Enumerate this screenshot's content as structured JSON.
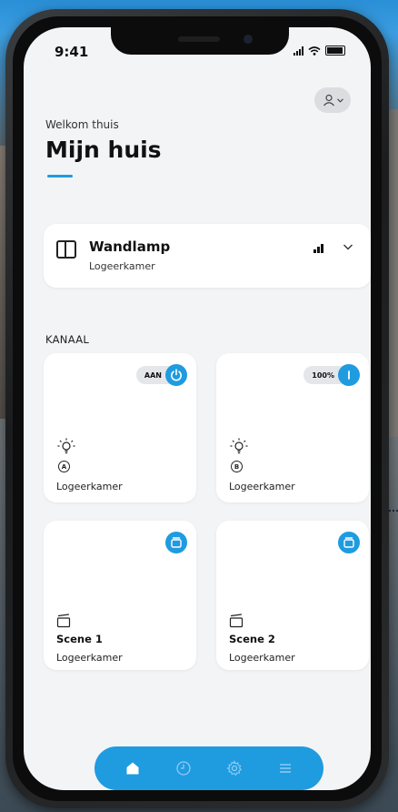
{
  "status_bar": {
    "time": "9:41"
  },
  "header": {
    "welcome": "Welkom thuis",
    "title": "Mijn huis"
  },
  "device": {
    "name": "Wandlamp",
    "room": "Logeerkamer"
  },
  "section_label": "KANAAL",
  "channels": [
    {
      "status": "AAN",
      "letter": "A",
      "room": "Logeerkamer"
    },
    {
      "status": "100%",
      "letter": "B",
      "room": "Logeerkamer"
    }
  ],
  "scenes": [
    {
      "name": "Scene 1",
      "room": "Logeerkamer"
    },
    {
      "name": "Scene 2",
      "room": "Logeerkamer"
    }
  ],
  "tabbar": {
    "items": [
      "home-icon",
      "clock-icon",
      "gear-icon",
      "menu-icon"
    ]
  },
  "colors": {
    "accent": "#1f9be0",
    "background": "#f3f4f5",
    "card": "#ffffff"
  }
}
